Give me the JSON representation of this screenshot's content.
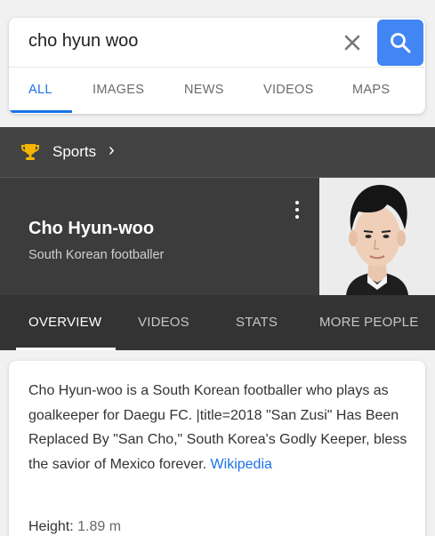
{
  "search": {
    "query": "cho hyun woo",
    "clear_icon": "close-icon",
    "search_icon": "search-icon"
  },
  "search_tabs": [
    {
      "label": "ALL",
      "active": true
    },
    {
      "label": "IMAGES",
      "active": false
    },
    {
      "label": "NEWS",
      "active": false
    },
    {
      "label": "VIDEOS",
      "active": false
    },
    {
      "label": "MAPS",
      "active": false
    }
  ],
  "sports": {
    "icon": "trophy-icon",
    "label": "Sports",
    "chevron": "›"
  },
  "entity": {
    "name": "Cho Hyun-woo",
    "description": "South Korean footballer"
  },
  "entity_tabs": [
    {
      "label": "OVERVIEW",
      "active": true
    },
    {
      "label": "VIDEOS",
      "active": false
    },
    {
      "label": "STATS",
      "active": false
    },
    {
      "label": "MORE PEOPLE",
      "active": false
    }
  ],
  "summary": {
    "text": "Cho Hyun-woo is a South Korean footballer who plays as goalkeeper for Daegu FC. |title=2018 \"San Zusi\" Has Been Replaced By \"San Cho,\" South Korea's Godly Keeper, bless the savior of Mexico forever.",
    "source_link": "Wikipedia"
  },
  "facts": {
    "height_label": "Height:",
    "height_value": "1.89 m"
  },
  "colors": {
    "accent": "#1a73e8",
    "search_button": "#4285f4",
    "dark_panel": "#3c3c3c"
  }
}
